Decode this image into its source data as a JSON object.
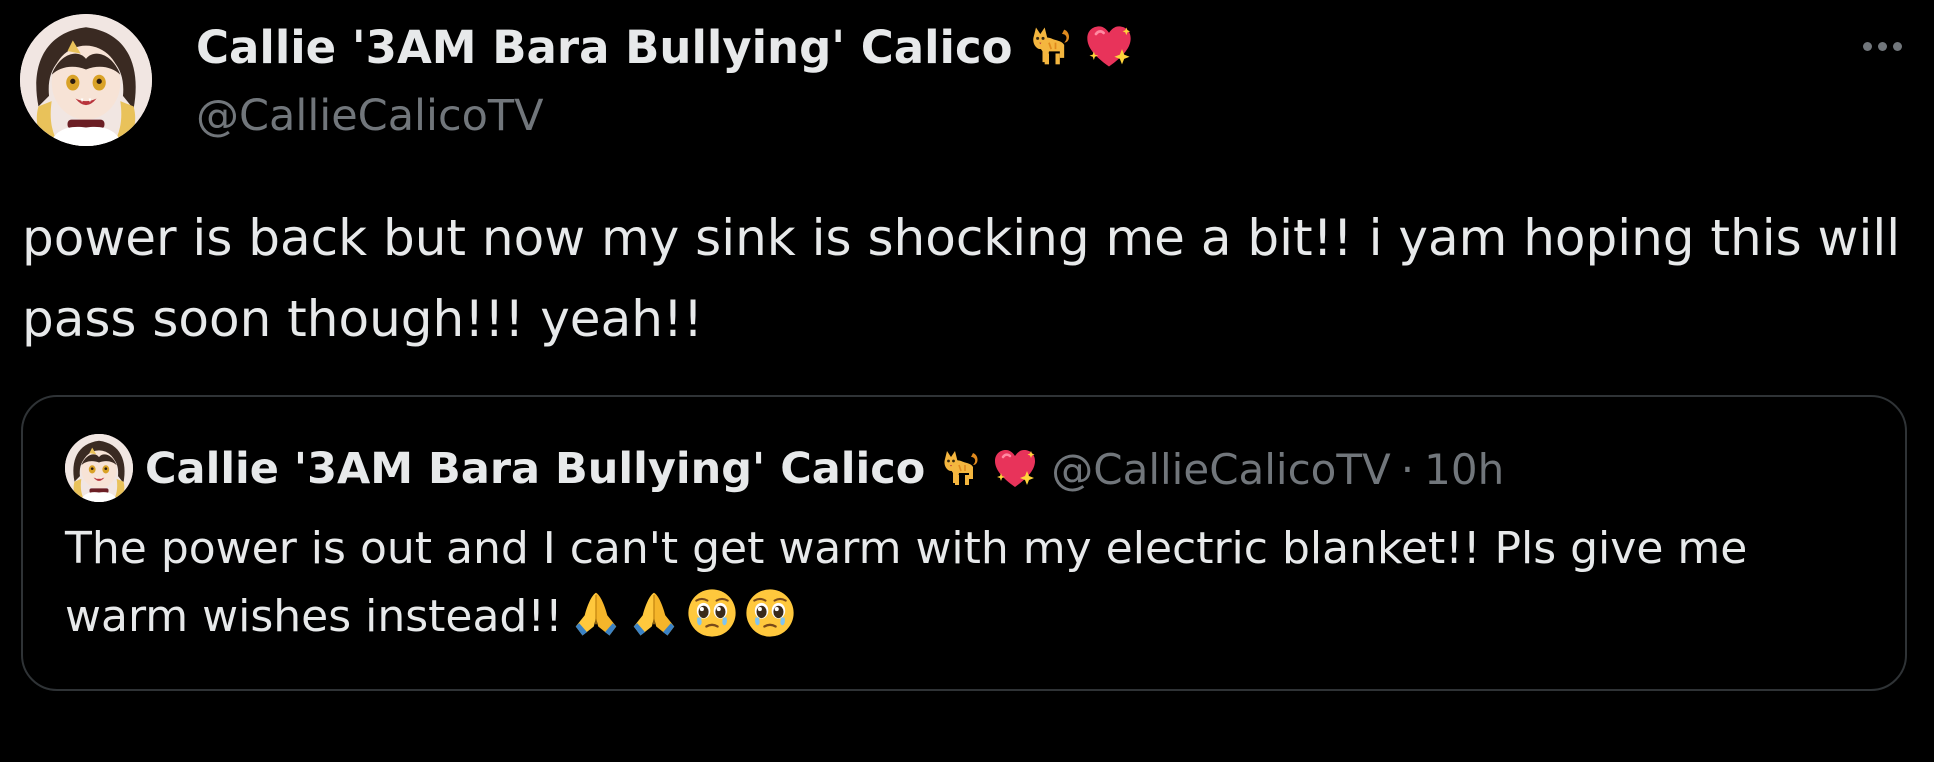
{
  "tweet": {
    "author": {
      "display_name": "Callie '3AM Bara Bullying' Calico",
      "handle": "@CallieCalicoTV",
      "avatar_icon": "anime-catgirl-avatar",
      "name_emojis": [
        "cat-emoji",
        "sparkling-heart-emoji"
      ]
    },
    "text": "power is back but now my sink is shocking me a bit!! i yam hoping this will pass soon though!!! yeah!!",
    "more_icon": "ellipsis-icon",
    "quoted_tweet": {
      "display_name": "Callie '3AM Bara Bullying' Calico",
      "handle": "@CallieCalicoTV",
      "separator": "·",
      "time": "10h",
      "name_emojis": [
        "cat-emoji",
        "sparkling-heart-emoji"
      ],
      "text": "The power is out and I can't get warm with my electric blanket!! Pls give me warm wishes instead!!",
      "text_emojis": [
        "folded-hands-emoji",
        "folded-hands-emoji",
        "pleading-face-emoji",
        "pleading-face-emoji"
      ]
    }
  },
  "colors": {
    "background": "#000000",
    "primary_text": "#e7e9ea",
    "secondary_text": "#71767b",
    "border": "#2f3336"
  }
}
